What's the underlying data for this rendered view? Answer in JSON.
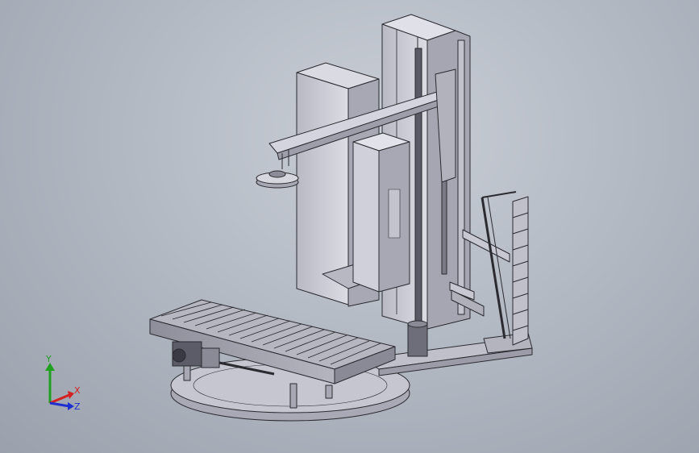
{
  "viewport": {
    "background_top": "#c9ced6",
    "background_bottom": "#9aa1ac"
  },
  "model": {
    "icon": "stretch-wrapping-machine-icon",
    "part_color": "#c8c8d2",
    "edge_color": "#2a2a30"
  },
  "triad": {
    "x_label": "X",
    "y_label": "Y",
    "z_label": "Z",
    "x_color": "#d42020",
    "y_color": "#20a020",
    "z_color": "#2030d0"
  }
}
